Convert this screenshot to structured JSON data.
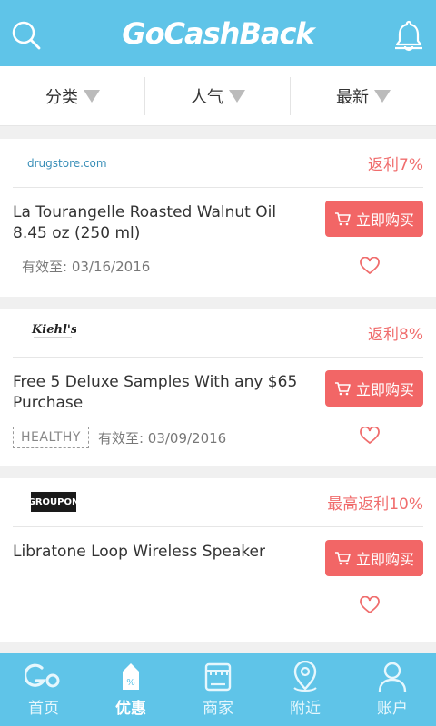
{
  "header": {
    "logo_text": "GoCashBack",
    "search_icon": "search-icon",
    "bell_icon": "bell-icon"
  },
  "filters": [
    {
      "label": "分类"
    },
    {
      "label": "人气"
    },
    {
      "label": "最新"
    }
  ],
  "deals": [
    {
      "merchant": "drugstore.com",
      "rebate": "返利7%",
      "title": "La Tourangelle Roasted Walnut Oil 8.45 oz (250 ml)",
      "tag": "",
      "valid": "有效至: 03/16/2016",
      "buy_label": "立即购买"
    },
    {
      "merchant": "Kiehl's",
      "rebate": "返利8%",
      "title": "Free 5 Deluxe Samples With any $65 Purchase",
      "tag": "HEALTHY",
      "valid": "有效至: 03/09/2016",
      "buy_label": "立即购买"
    },
    {
      "merchant": "GROUPON",
      "rebate": "最高返利10%",
      "title": "Libratone Loop Wireless Speaker",
      "tag": "",
      "valid": "",
      "buy_label": "立即购买"
    }
  ],
  "tabs": [
    {
      "label": "首页",
      "icon": "home-go-icon"
    },
    {
      "label": "优惠",
      "icon": "coupon-tag-icon",
      "active": true
    },
    {
      "label": "商家",
      "icon": "store-icon"
    },
    {
      "label": "附近",
      "icon": "location-pin-icon"
    },
    {
      "label": "账户",
      "icon": "user-icon"
    }
  ],
  "colors": {
    "primary": "#5fc4e8",
    "accent": "#f26666",
    "rebate_text": "#f06d6d"
  }
}
